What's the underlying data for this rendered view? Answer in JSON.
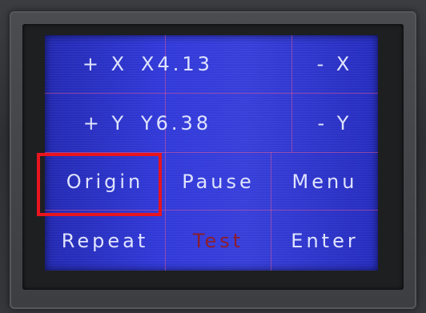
{
  "screen": {
    "accent_color": "#2b33d8",
    "highlight_color": "#e8141e",
    "rows": [
      {
        "left": "+ X",
        "readout": "X4.13",
        "right": "- X"
      },
      {
        "left": "+ Y",
        "readout": "Y6.38",
        "right": "- Y"
      },
      {
        "left": "Origin",
        "middle": "Pause",
        "right": "Menu"
      },
      {
        "left": "Repeat",
        "middle": "Test",
        "right": "Enter"
      }
    ]
  }
}
